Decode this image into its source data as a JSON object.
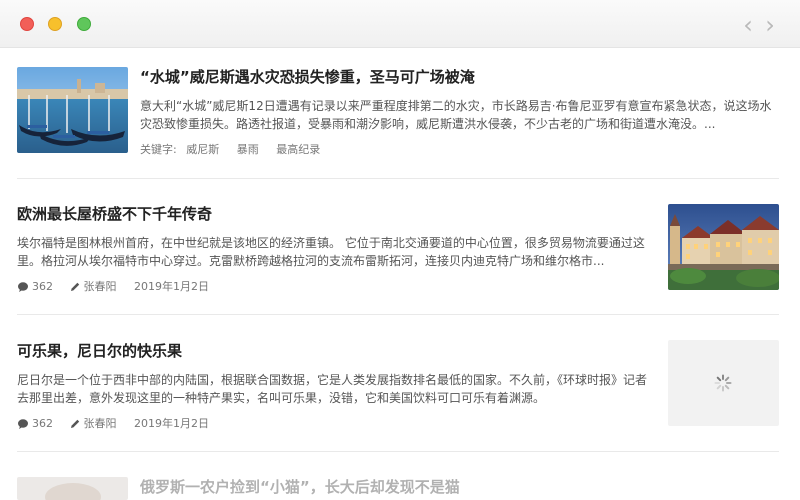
{
  "window": {
    "back_label": "‹",
    "forward_label": "›"
  },
  "articles": [
    {
      "title": "“水城”威尼斯遇水灾恐损失惨重，圣马可广场被淹",
      "summary": "意大利“水城”威尼斯12日遭遇有记录以来严重程度排第二的水灾，市长路易吉·布鲁尼亚罗有意宣布紧急状态，说这场水灾恐致惨重损失。路透社报道，受暴雨和潮汐影响，威尼斯遭洪水侵袭，不少古老的广场和街道遭水淹没。...",
      "keywords_label": "关键字:",
      "keywords": [
        "威尼斯",
        "暴雨",
        "最高纪录"
      ],
      "image_icon": "venice-canal-photo"
    },
    {
      "title": "欧洲最长屋桥盛不下千年传奇",
      "summary": "埃尔福特是图林根州首府，在中世纪就是该地区的经济重镇。 它位于南北交通要道的中心位置，很多贸易物流要通过这里。格拉河从埃尔福特市中心穿过。克雷默桥跨越格拉河的支流布雷斯拓河，连接贝内迪克特广场和维尔格市...",
      "comments": "362",
      "author": "张春阳",
      "date": "2019年1月2日",
      "image_icon": "bridge-houses-photo"
    },
    {
      "title": "可乐果，尼日尔的快乐果",
      "summary": "尼日尔是一个位于西非中部的内陆国，根据联合国数据，它是人类发展指数排名最低的国家。不久前，《环球时报》记者去那里出差，意外发现这里的一种特产果实，名叫可乐果，没错，它和美国饮料可口可乐有着渊源。",
      "comments": "362",
      "author": "张春阳",
      "date": "2019年1月2日",
      "image_icon": "loading-spinner-icon"
    },
    {
      "title": "俄罗斯一农户捡到“小猫”，长大后却发现不是猫"
    }
  ]
}
